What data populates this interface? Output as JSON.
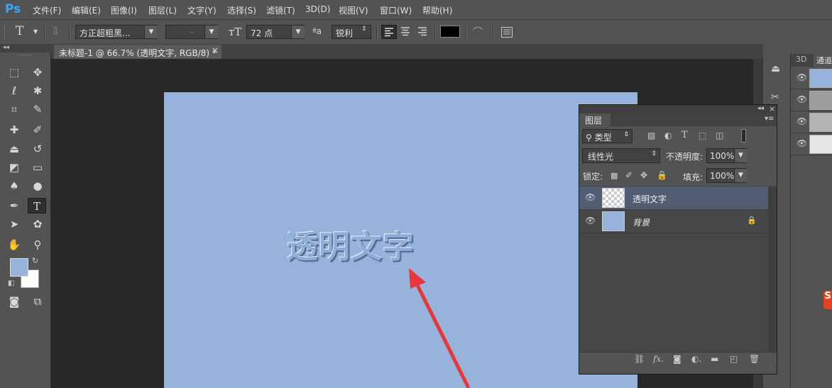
{
  "app": {
    "logo": "Ps"
  },
  "menu": [
    "文件(F)",
    "编辑(E)",
    "图像(I)",
    "图层(L)",
    "文字(Y)",
    "选择(S)",
    "滤镜(T)",
    "3D(D)",
    "视图(V)",
    "窗口(W)",
    "帮助(H)"
  ],
  "options": {
    "tool_glyph": "T",
    "font_family": "方正超粗黑...",
    "font_style": "-",
    "font_size": "72 点",
    "aa_label": "ªa",
    "antialias": "锐利",
    "color_hex": "#000000"
  },
  "document": {
    "tab_title": "未标题-1 @ 66.7% (透明文字, RGB/8) *",
    "close": "×"
  },
  "canvas": {
    "background": "#97b3dc",
    "text": "透明文字"
  },
  "right_panel": {
    "tabs": [
      "3D",
      "通道"
    ]
  },
  "layers_panel": {
    "title": "图层",
    "filter_kind": "类型",
    "blend_mode": "线性光",
    "opacity_label": "不透明度:",
    "opacity_value": "100%",
    "lock_label": "锁定:",
    "fill_label": "填充:",
    "fill_value": "100%",
    "layers": [
      {
        "name": "透明文字",
        "selected": true,
        "locked": false
      },
      {
        "name": "背景",
        "selected": false,
        "locked": true
      }
    ]
  },
  "colors": {
    "accent_ps": "#31a8ff",
    "arrow": "#e8373a",
    "canvas": "#97b3dc"
  }
}
